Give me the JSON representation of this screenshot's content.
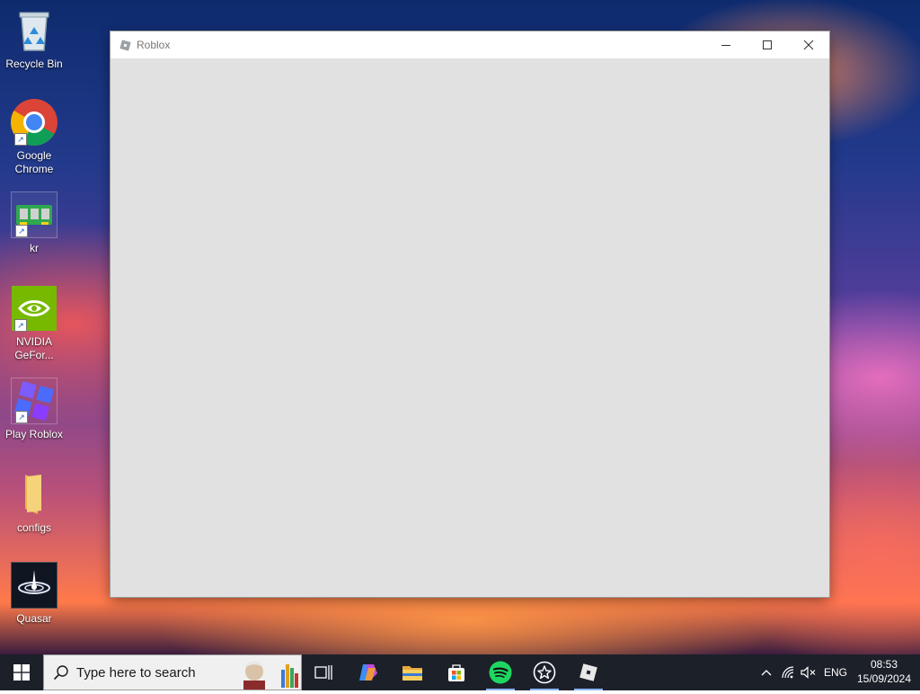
{
  "desktop": {
    "icons": [
      {
        "label": "Recycle Bin",
        "icon": "recycle-bin-icon"
      },
      {
        "label": "Google Chrome",
        "icon": "chrome-icon"
      },
      {
        "label": "kr",
        "icon": "memory-card-icon"
      },
      {
        "label": "NVIDIA GeFor...",
        "icon": "nvidia-icon"
      },
      {
        "label": "Play Roblox",
        "icon": "roblox-studio-icon"
      },
      {
        "label": "configs",
        "icon": "folder-icon"
      },
      {
        "label": "Quasar",
        "icon": "quasar-icon"
      }
    ]
  },
  "window": {
    "title": "Roblox",
    "icon": "roblox-icon",
    "controls": [
      "minimize-icon",
      "maximize-icon",
      "close-icon"
    ]
  },
  "taskbar": {
    "search_placeholder": "Type here to search",
    "apps": [
      {
        "name": "task-view",
        "icon": "task-view-icon"
      },
      {
        "name": "copilot",
        "icon": "copilot-icon"
      },
      {
        "name": "file-explorer",
        "icon": "folder-icon"
      },
      {
        "name": "microsoft-store",
        "icon": "store-icon"
      },
      {
        "name": "spotify",
        "icon": "spotify-icon"
      },
      {
        "name": "game-app",
        "icon": "star-icon"
      },
      {
        "name": "roblox",
        "icon": "roblox-icon"
      }
    ],
    "tray": {
      "language": "ENG",
      "time": "08:53",
      "date": "15/09/2024"
    }
  },
  "colors": {
    "taskbar_bg": "#1c2029",
    "window_client": "#e1e1e1",
    "active_indicator": "#8ab4f8",
    "spotify_green": "#1ed760",
    "nvidia_green": "#76b900"
  }
}
